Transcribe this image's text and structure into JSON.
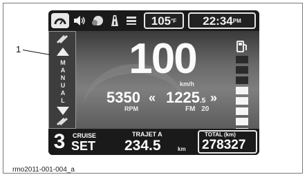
{
  "top_bar": {
    "icons": [
      "gauge-icon",
      "speaker-icon",
      "heated-grip-icon",
      "road-icon",
      "menu-icon"
    ],
    "temperature": "105",
    "temperature_unit": "°F",
    "clock": "22:34",
    "clock_suffix": "PM"
  },
  "gear_mode": {
    "letters": [
      "M",
      "A",
      "N",
      "U",
      "A",
      "L"
    ]
  },
  "speed": {
    "value": "100",
    "unit": "km/h"
  },
  "rpm": {
    "value": "5350",
    "label": "RPM"
  },
  "radio": {
    "frequency": "1225",
    "frequency_decimal": "5",
    "band": "FM",
    "preset": "20"
  },
  "fuel_gauge": {
    "level_bars_on": 5,
    "total_bars": 8
  },
  "bottom_bar": {
    "gear": "3",
    "cruise_label": "CRUISE",
    "cruise_value": "SET",
    "trip_label": "TRAJET A",
    "trip_value": "234.5",
    "trip_unit": "km",
    "total_label": "TOTAL (km)",
    "total_value": "278327"
  },
  "annotation": {
    "callout_number": "1",
    "caption": "rmo2011-001-004_a"
  }
}
